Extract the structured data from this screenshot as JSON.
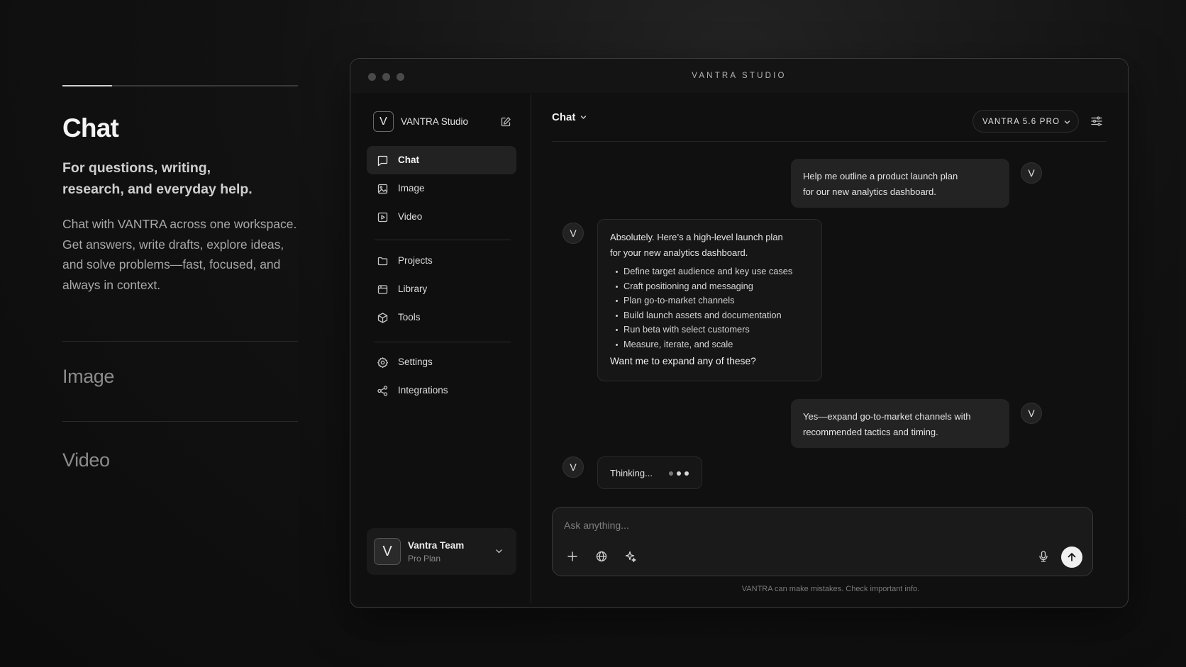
{
  "left_panel": {
    "progress_fraction": 0.21,
    "title": "Chat",
    "subtitle": "For questions, writing, research, and everyday help.",
    "description": "Chat with VANTRA across one workspace. Get answers, write drafts, explore ideas, and solve problems—fast, focused, and always in context.",
    "sections": [
      {
        "label": "Image"
      },
      {
        "label": "Video"
      }
    ]
  },
  "window": {
    "title": "VANTRA STUDIO"
  },
  "sidebar": {
    "brand_initial": "V",
    "brand_name": "VANTRA Studio",
    "items": [
      {
        "label": "Chat",
        "icon": "chat-icon",
        "active": true
      },
      {
        "label": "Image",
        "icon": "image-icon"
      },
      {
        "label": "Video",
        "icon": "video-icon"
      },
      {
        "label": "Projects",
        "icon": "folder-icon"
      },
      {
        "label": "Library",
        "icon": "library-icon"
      },
      {
        "label": "Tools",
        "icon": "cube-icon"
      },
      {
        "label": "Settings",
        "icon": "gear-icon"
      },
      {
        "label": "Integrations",
        "icon": "share-icon"
      }
    ],
    "account": {
      "initial": "V",
      "name": "Vantra Team",
      "plan": "Pro Plan"
    }
  },
  "main": {
    "mode_label": "Chat",
    "model_label": "VANTRA 5.6 PRO",
    "messages": [
      {
        "role": "user",
        "avatar": "V",
        "lines": [
          "Help me outline a product launch plan",
          "for our new analytics dashboard."
        ]
      },
      {
        "role": "assistant",
        "avatar": "V",
        "lines": [
          "Absolutely. Here’s a high-level launch plan",
          "for your new analytics dashboard."
        ],
        "bullets": [
          "Define target audience and key use cases",
          "Craft positioning and messaging",
          "Plan go-to-market channels",
          "Build launch assets and documentation",
          "Run beta with select customers",
          "Measure, iterate, and scale"
        ],
        "question": "Want me to expand any of these?"
      },
      {
        "role": "user",
        "avatar": "V",
        "lines": [
          "Yes—expand go-to-market channels with",
          "recommended tactics and timing."
        ]
      },
      {
        "role": "assistant",
        "avatar": "V",
        "status": "Thinking..."
      }
    ],
    "composer": {
      "placeholder": "Ask anything...",
      "value": ""
    },
    "disclaimer": "VANTRA can make mistakes. Check important info."
  },
  "colors": {
    "background": "#0f0f0f",
    "panel": "#1a1a1a",
    "accent": "#efefef",
    "muted": "#8b8b8b"
  }
}
